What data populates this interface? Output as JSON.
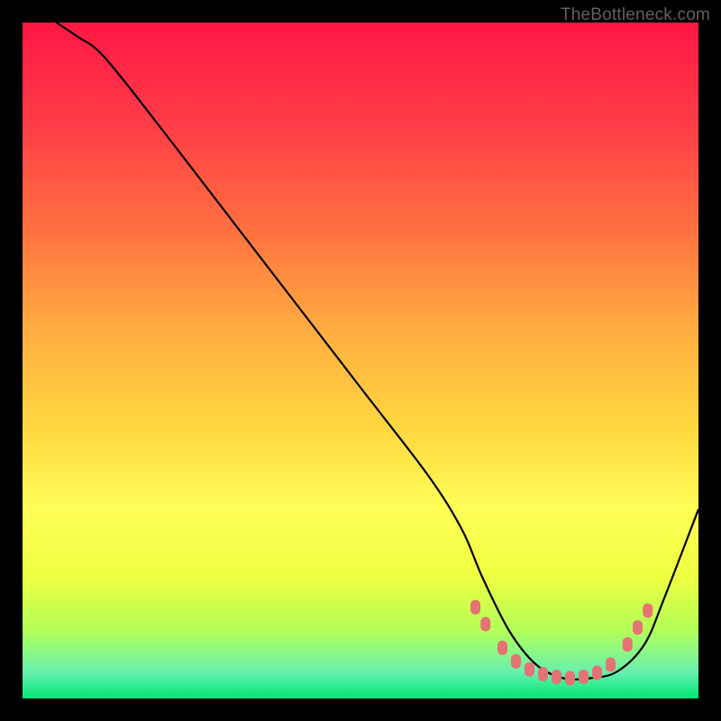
{
  "watermark": "TheBottleneck.com",
  "chart_data": {
    "type": "line",
    "title": "",
    "xlabel": "",
    "ylabel": "",
    "xlim": [
      0,
      100
    ],
    "ylim": [
      0,
      100
    ],
    "gradient_stops": [
      {
        "offset": 0,
        "color": "#ff1744"
      },
      {
        "offset": 15,
        "color": "#ff3d47"
      },
      {
        "offset": 30,
        "color": "#ff6e40"
      },
      {
        "offset": 45,
        "color": "#ffab40"
      },
      {
        "offset": 60,
        "color": "#ffd740"
      },
      {
        "offset": 72,
        "color": "#ffff57"
      },
      {
        "offset": 82,
        "color": "#eeff41"
      },
      {
        "offset": 90,
        "color": "#b2ff59"
      },
      {
        "offset": 96,
        "color": "#69f0ae"
      },
      {
        "offset": 100,
        "color": "#00e676"
      }
    ],
    "series": [
      {
        "name": "bottleneck-curve",
        "x": [
          5,
          8,
          12,
          20,
          30,
          40,
          50,
          60,
          65,
          68,
          72,
          76,
          80,
          84,
          88,
          92,
          95,
          100
        ],
        "y": [
          100,
          98,
          95,
          85,
          72,
          59,
          46,
          33,
          25,
          18,
          10,
          5,
          3,
          3,
          4,
          8,
          15,
          28
        ]
      }
    ],
    "markers": {
      "name": "optimal-points",
      "points": [
        {
          "x": 67,
          "y": 13.5
        },
        {
          "x": 68.5,
          "y": 11
        },
        {
          "x": 71,
          "y": 7.5
        },
        {
          "x": 73,
          "y": 5.5
        },
        {
          "x": 75,
          "y": 4.3
        },
        {
          "x": 77,
          "y": 3.6
        },
        {
          "x": 79,
          "y": 3.2
        },
        {
          "x": 81,
          "y": 3
        },
        {
          "x": 83,
          "y": 3.2
        },
        {
          "x": 85,
          "y": 3.8
        },
        {
          "x": 87,
          "y": 5
        },
        {
          "x": 89.5,
          "y": 8
        },
        {
          "x": 91,
          "y": 10.5
        },
        {
          "x": 92.5,
          "y": 13
        }
      ],
      "color": "#e57373"
    }
  }
}
